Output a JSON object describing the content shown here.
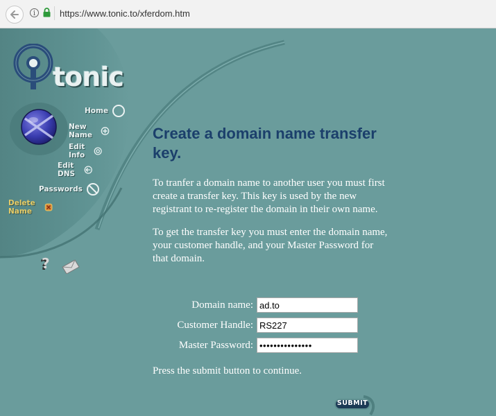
{
  "browser": {
    "url": "https://www.tonic.to/xferdom.htm"
  },
  "logo": {
    "text": "tonic"
  },
  "nav": {
    "items": [
      {
        "label": "Home",
        "icon": "circle-icon"
      },
      {
        "label": "New Name",
        "icon": "plus-circle-icon"
      },
      {
        "label": "Edit Info",
        "icon": "target-circle-icon"
      },
      {
        "label": "Edit DNS",
        "icon": "arrow-left-circle-icon"
      },
      {
        "label": "Passwords",
        "icon": "prohibited-circle-icon"
      },
      {
        "label": "Delete Name",
        "icon": "delete-x-icon",
        "active": true
      }
    ]
  },
  "content": {
    "title": "Create a domain name transfer key.",
    "paragraph1": "To tranfer a domain name to another user you must first create a transfer key. This key is used by the new registrant to re-register the domain in their own name.",
    "paragraph2": "To get the transfer key you must enter the domain name, your customer handle, and your Master Password for that domain."
  },
  "form": {
    "domain_label": "Domain name:",
    "domain_value": "ad.to",
    "handle_label": "Customer Handle:",
    "handle_value": "RS227",
    "password_label": "Master Password:",
    "password_value": "•••••••••••••••"
  },
  "footer": {
    "press_text": "Press the submit button to continue.",
    "submit_label": "SUBMIT"
  },
  "colors": {
    "background": "#6a9c9c",
    "title": "#1b3f6b",
    "active_nav": "#e8cc66"
  }
}
